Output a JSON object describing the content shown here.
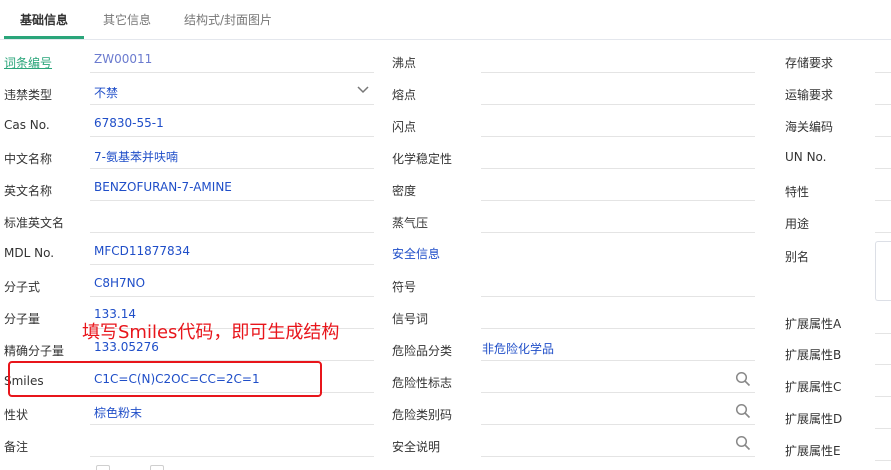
{
  "tabs": [
    {
      "label": "基础信息"
    },
    {
      "label": "其它信息"
    },
    {
      "label": "结构式/封面图片"
    }
  ],
  "col1": {
    "entry_no": {
      "label": "词条编号",
      "value": "ZW00011"
    },
    "prohibited_type": {
      "label": "违禁类型",
      "value": "不禁"
    },
    "cas_no": {
      "label": "Cas No.",
      "value": "67830-55-1"
    },
    "cn_name": {
      "label": "中文名称",
      "value": "7-氨基苯并呋喃"
    },
    "en_name": {
      "label": "英文名称",
      "value": "BENZOFURAN-7-AMINE"
    },
    "std_en_name": {
      "label": "标准英文名",
      "value": ""
    },
    "mdl_no": {
      "label": "MDL No.",
      "value": "MFCD11877834"
    },
    "formula": {
      "label": "分子式",
      "value": "C8H7NO"
    },
    "mol_weight": {
      "label": "分子量",
      "value": "133.14"
    },
    "exact_mass": {
      "label": "精确分子量",
      "value": "133.05276"
    },
    "smiles": {
      "label": "Smiles",
      "value": "C1C=C(N)C2OC=CC=2C=1"
    },
    "appearance": {
      "label": "性状",
      "value": "棕色粉末"
    },
    "remarks": {
      "label": "备注",
      "value": ""
    }
  },
  "col2": {
    "boiling_point": {
      "label": "沸点"
    },
    "melting_point": {
      "label": "熔点"
    },
    "flash_point": {
      "label": "闪点"
    },
    "chem_stability": {
      "label": "化学稳定性"
    },
    "density": {
      "label": "密度"
    },
    "vapor_pressure": {
      "label": "蒸气压"
    },
    "safety_info": {
      "label": "安全信息"
    },
    "symbol": {
      "label": "符号"
    },
    "signal_word": {
      "label": "信号词"
    },
    "hazard_class": {
      "label": "危险品分类",
      "value": "非危险化学品"
    },
    "hazard_mark": {
      "label": "危险性标志"
    },
    "hazard_code": {
      "label": "危险类别码"
    },
    "safety_desc": {
      "label": "安全说明"
    }
  },
  "col3": {
    "storage": {
      "label": "存储要求"
    },
    "transport": {
      "label": "运输要求"
    },
    "customs_code": {
      "label": "海关编码"
    },
    "un_no": {
      "label": "UN No."
    },
    "property": {
      "label": "特性"
    },
    "usage": {
      "label": "用途"
    },
    "alias": {
      "label": "别名"
    },
    "ext_a": {
      "label": "扩展属性A"
    },
    "ext_b": {
      "label": "扩展属性B"
    },
    "ext_c": {
      "label": "扩展属性C"
    },
    "ext_d": {
      "label": "扩展属性D"
    },
    "ext_e": {
      "label": "扩展属性E"
    }
  },
  "annotation": {
    "text": "填写Smiles代码，即可生成结构"
  },
  "colors": {
    "accent": "#2aa57a",
    "value_blue": "#1f4ec8",
    "annotation_red": "#e8151b"
  }
}
